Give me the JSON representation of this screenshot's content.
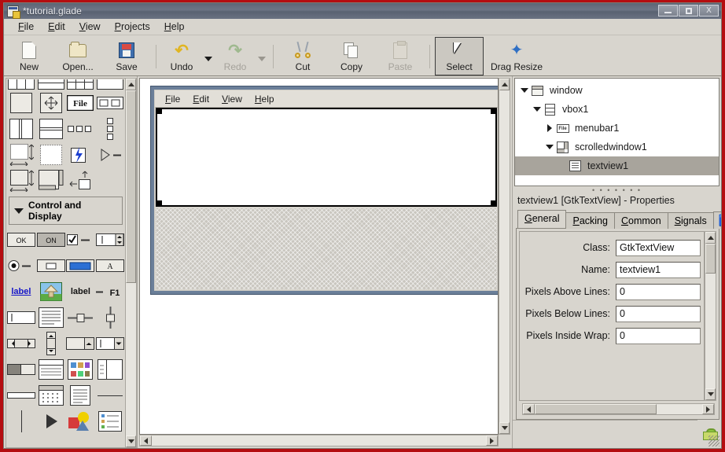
{
  "window": {
    "title": "*tutorial.glade",
    "icon": "glade-app-icon",
    "controls": [
      {
        "name": "minimize-button",
        "glyph": "—"
      },
      {
        "name": "maximize-button",
        "glyph": "❐"
      },
      {
        "name": "close-button",
        "glyph": "X"
      }
    ]
  },
  "menubar": {
    "items": [
      {
        "label": "File",
        "mnemonic": "F"
      },
      {
        "label": "Edit",
        "mnemonic": "E"
      },
      {
        "label": "View",
        "mnemonic": "V"
      },
      {
        "label": "Projects",
        "mnemonic": "P"
      },
      {
        "label": "Help",
        "mnemonic": "H"
      }
    ]
  },
  "toolbar": {
    "items": [
      {
        "label": "New",
        "icon": "new-document-icon",
        "enabled": true,
        "selected": false
      },
      {
        "label": "Open...",
        "icon": "open-folder-icon",
        "enabled": true,
        "selected": false
      },
      {
        "label": "Save",
        "icon": "save-floppy-icon",
        "enabled": true,
        "selected": false
      },
      {
        "label": "Undo",
        "icon": "undo-arrow-icon",
        "enabled": true,
        "selected": false
      },
      {
        "label": "Redo",
        "icon": "redo-arrow-icon",
        "enabled": false,
        "selected": false
      },
      {
        "label": "Cut",
        "icon": "scissors-icon",
        "enabled": true,
        "selected": false
      },
      {
        "label": "Copy",
        "icon": "copy-pages-icon",
        "enabled": true,
        "selected": false
      },
      {
        "label": "Paste",
        "icon": "clipboard-icon",
        "enabled": false,
        "selected": false
      },
      {
        "label": "Select",
        "icon": "mouse-pointer-icon",
        "enabled": true,
        "selected": true
      },
      {
        "label": "Drag Resize",
        "icon": "move-arrows-icon",
        "enabled": true,
        "selected": false
      }
    ]
  },
  "palette": {
    "container_icons": [
      "hbox-three-icon",
      "vbox-two-icon",
      "table-grid-icon",
      "frame-icon",
      "fixed-icon",
      "alignment-icon",
      "menubar-icon",
      "hbutton-box-icon",
      "hpaned-icon",
      "vpaned-icon",
      "toolbar-dots-icon",
      "vtoolbar-dots-icon",
      "scrolled-window-icon",
      "viewport-icon",
      "event-box-icon",
      "expander-icon",
      "aspect-frame-icon",
      "layout-icon",
      "size-group-icon"
    ],
    "group": {
      "label": "Control and Display",
      "expanded": true
    },
    "control_icons": [
      {
        "name": "button-icon",
        "text": "OK"
      },
      {
        "name": "toggle-button-icon",
        "text": "ON"
      },
      {
        "name": "check-button-icon",
        "text": ""
      },
      {
        "name": "spin-button-icon",
        "text": ""
      },
      {
        "name": "radio-button-icon",
        "text": ""
      },
      {
        "name": "file-chooser-button-icon",
        "text": ""
      },
      {
        "name": "color-button-icon",
        "text": ""
      },
      {
        "name": "font-button-icon",
        "text": "A"
      },
      {
        "name": "link-button-icon",
        "text": "label"
      },
      {
        "name": "image-icon",
        "text": ""
      },
      {
        "name": "label-icon",
        "text": "label"
      },
      {
        "name": "accel-label-icon",
        "text": "F1"
      },
      {
        "name": "entry-icon",
        "text": ""
      },
      {
        "name": "text-view-icon",
        "text": ""
      },
      {
        "name": "hscale-icon",
        "text": ""
      },
      {
        "name": "vscale-icon",
        "text": ""
      },
      {
        "name": "hscrollbar-icon",
        "text": ""
      },
      {
        "name": "vscrollbar-icon",
        "text": ""
      },
      {
        "name": "combo-box-icon",
        "text": ""
      },
      {
        "name": "combo-box-entry-icon",
        "text": ""
      },
      {
        "name": "progress-bar-icon",
        "text": ""
      },
      {
        "name": "tree-view-icon",
        "text": ""
      },
      {
        "name": "icon-view-icon",
        "text": ""
      },
      {
        "name": "list-view-icon",
        "text": ""
      },
      {
        "name": "horizontal-separator-icon",
        "text": ""
      },
      {
        "name": "calendar-icon",
        "text": ""
      },
      {
        "name": "text-page-icon",
        "text": ""
      },
      {
        "name": "hseparator-line-icon",
        "text": ""
      },
      {
        "name": "vseparator-icon",
        "text": ""
      },
      {
        "name": "arrow-icon",
        "text": ""
      },
      {
        "name": "drawing-area-icon",
        "text": ""
      },
      {
        "name": "icon-list-icon",
        "text": ""
      }
    ]
  },
  "canvas": {
    "mock_window": {
      "menubar_items": [
        {
          "label": "File",
          "mnemonic": "F"
        },
        {
          "label": "Edit",
          "mnemonic": "E"
        },
        {
          "label": "View",
          "mnemonic": "V"
        },
        {
          "label": "Help",
          "mnemonic": "H"
        }
      ],
      "selected_widget": "textview1",
      "placeholder": "empty-placeholder"
    }
  },
  "tree": {
    "rows": [
      {
        "label": "window",
        "icon": "window-icon",
        "depth": 0,
        "expander": "expanded",
        "selected": false
      },
      {
        "label": "vbox1",
        "icon": "vbox-icon",
        "depth": 1,
        "expander": "expanded",
        "selected": false
      },
      {
        "label": "menubar1",
        "icon": "menubar-icon",
        "depth": 2,
        "expander": "collapsed",
        "selected": false
      },
      {
        "label": "scrolledwindow1",
        "icon": "scrolled-window-icon",
        "depth": 2,
        "expander": "expanded",
        "selected": false
      },
      {
        "label": "textview1",
        "icon": "text-view-icon",
        "depth": 3,
        "expander": "none",
        "selected": true
      }
    ]
  },
  "properties": {
    "title": "textview1 [GtkTextView] - Properties",
    "tabs": [
      {
        "label": "General",
        "mnemonic": "G",
        "active": true
      },
      {
        "label": "Packing",
        "mnemonic": "P",
        "active": false
      },
      {
        "label": "Common",
        "mnemonic": "C",
        "active": false
      },
      {
        "label": "Signals",
        "mnemonic": "S",
        "active": false
      },
      {
        "label": "",
        "icon": "accessibility-icon",
        "active": false
      }
    ],
    "rows": [
      {
        "label": "Class:",
        "value": "GtkTextView"
      },
      {
        "label": "Name:",
        "value": "textview1"
      },
      {
        "label": "Pixels Above Lines:",
        "value": "0"
      },
      {
        "label": "Pixels Below Lines:",
        "value": "0"
      },
      {
        "label": "Pixels Inside Wrap:",
        "value": "0"
      }
    ]
  },
  "statusbar": {
    "lock_icon": "lock-icon"
  },
  "colors": {
    "frame_red": "#b40d10",
    "titlebar": "#6d7585",
    "background": "#d8d5ce",
    "selection": "#a8a49c",
    "mockwin_border": "#6b7f99"
  }
}
